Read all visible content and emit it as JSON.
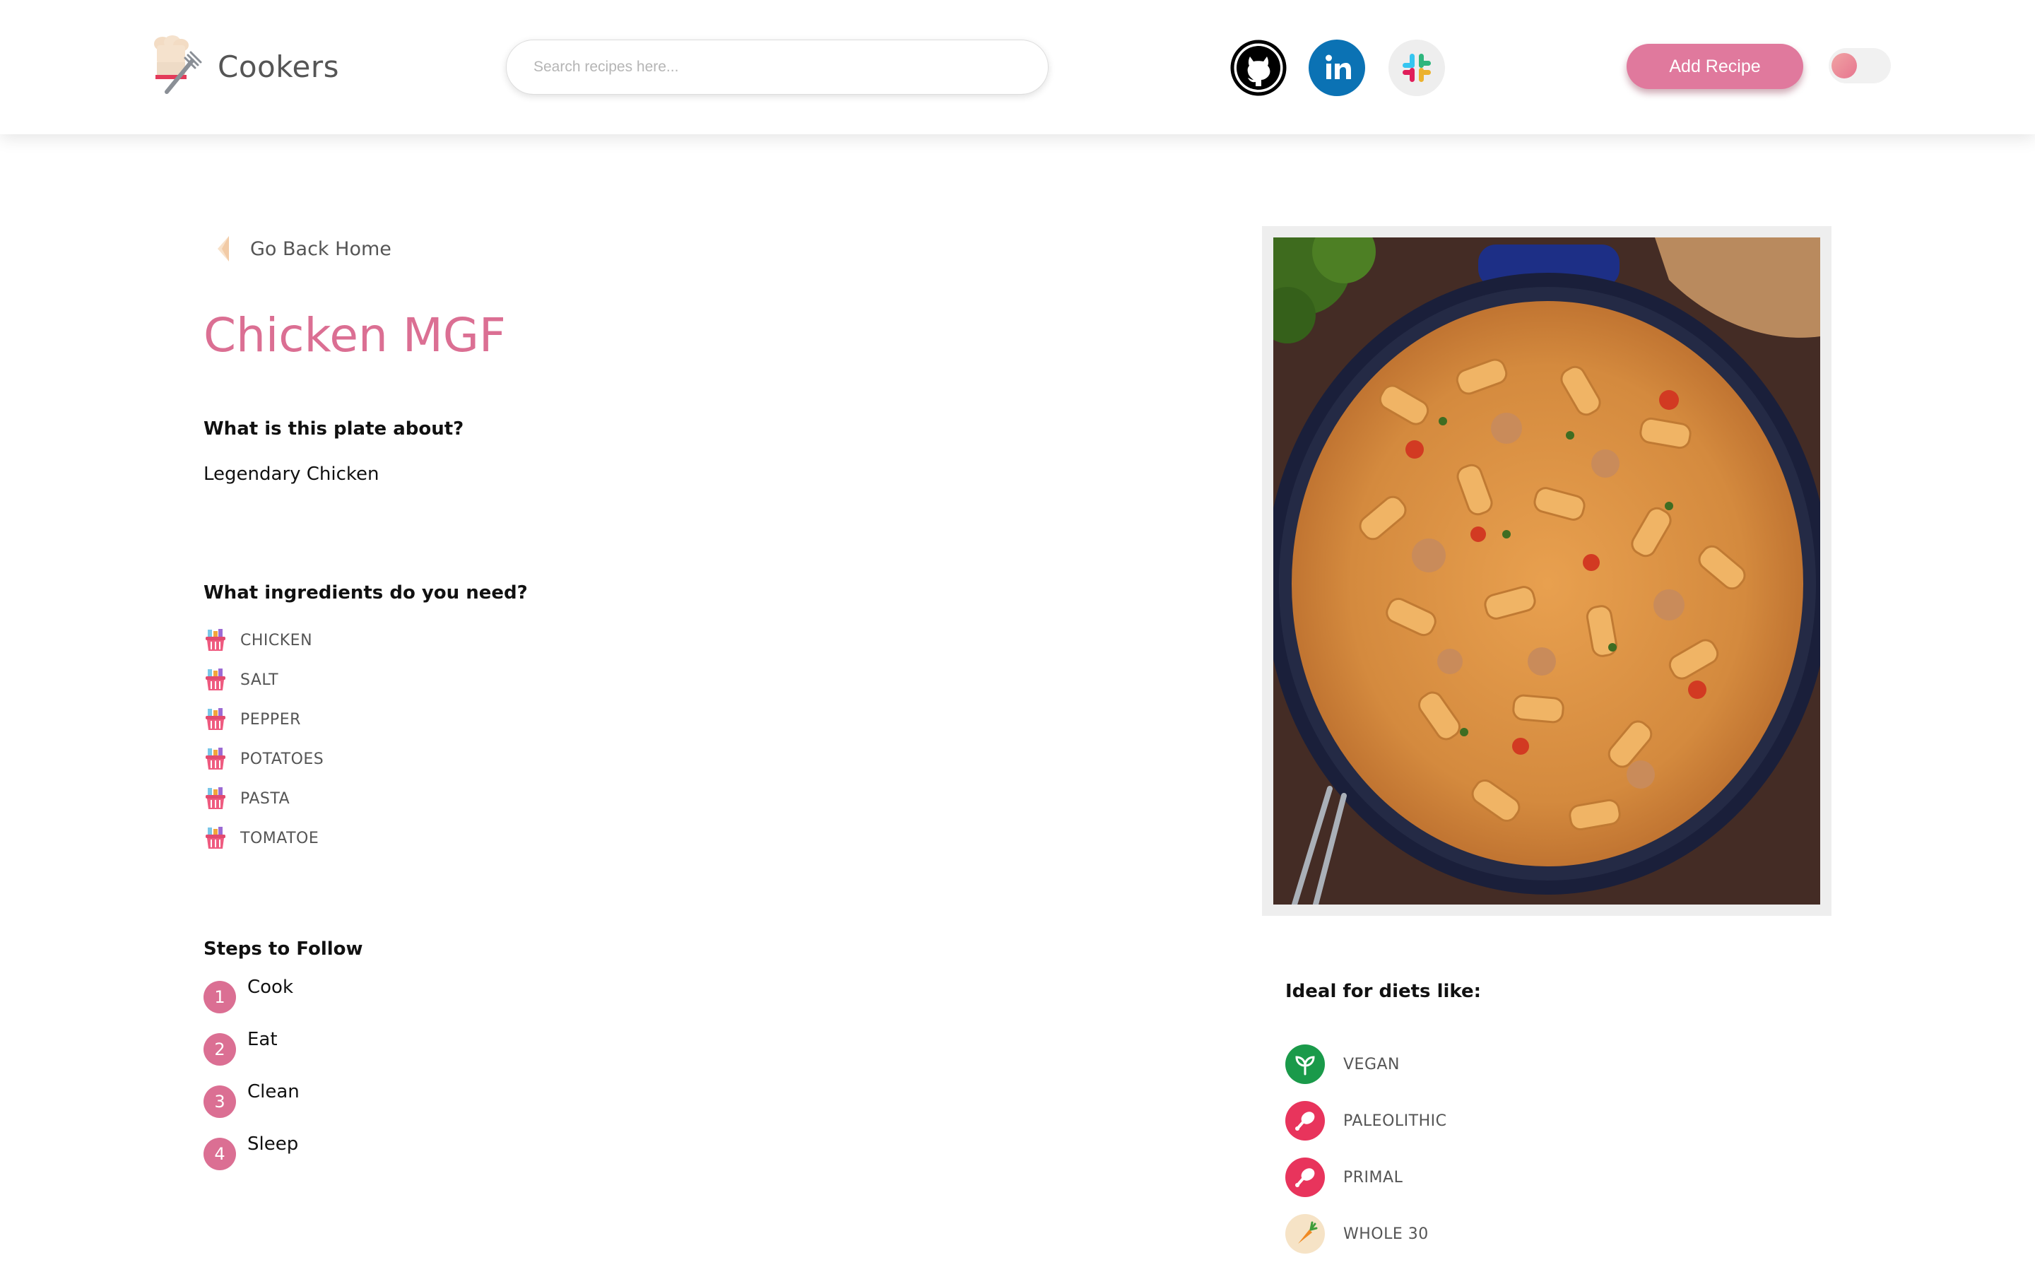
{
  "header": {
    "brand": "Cookers",
    "search_placeholder": "Search recipes here...",
    "add_recipe_label": "Add Recipe",
    "social": [
      "github-icon",
      "linkedin-icon",
      "slack-icon"
    ]
  },
  "colors": {
    "accent": "#db6f93",
    "button": "#e0799d",
    "linkedin": "#0b72b4",
    "vegan": "#1a9a4a",
    "paleo": "#e8345c"
  },
  "recipe": {
    "back_label": "Go Back Home",
    "title": "Chicken MGF",
    "about_heading": "What is this plate about?",
    "about_text": "Legendary Chicken",
    "ingredients_heading": "What ingredients do you need?",
    "ingredients": [
      "CHICKEN",
      "SALT",
      "PEPPER",
      "POTATOES",
      "PASTA",
      "TOMATOE"
    ],
    "steps_heading": "Steps to Follow",
    "steps": [
      {
        "num": "1",
        "text": "Cook"
      },
      {
        "num": "2",
        "text": "Eat"
      },
      {
        "num": "3",
        "text": "Clean"
      },
      {
        "num": "4",
        "text": "Sleep"
      }
    ],
    "diets_heading": "Ideal for diets like:",
    "diets": [
      {
        "name": "VEGAN",
        "icon": "leaf-icon"
      },
      {
        "name": "PALEOLITHIC",
        "icon": "drumstick-icon"
      },
      {
        "name": "PRIMAL",
        "icon": "drumstick-icon"
      },
      {
        "name": "WHOLE 30",
        "icon": "carrot-icon"
      }
    ]
  }
}
